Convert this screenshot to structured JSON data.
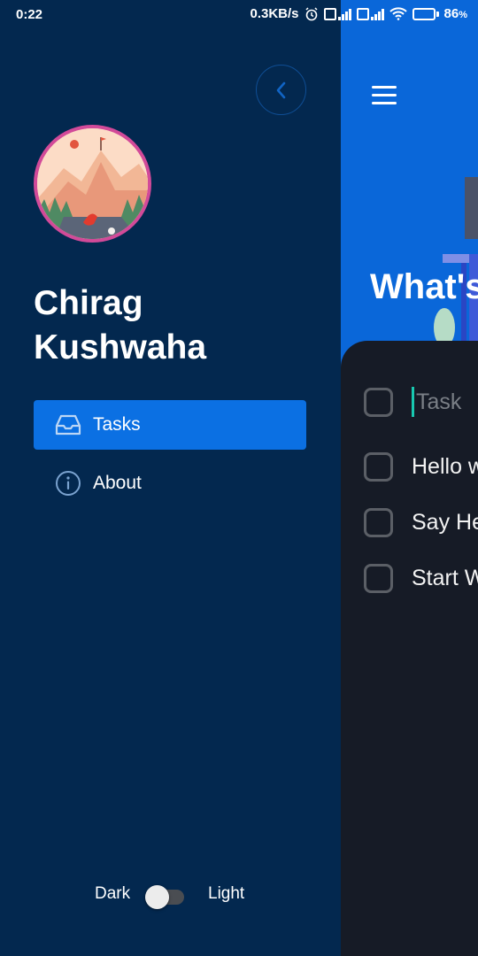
{
  "status_bar": {
    "time": "0:22",
    "net_speed": "0.3KB/s",
    "battery_level": "86",
    "battery_unit": "%",
    "icons": [
      "alarm-icon",
      "sim-signal-icon",
      "sim-signal-icon",
      "wifi-icon",
      "battery-icon"
    ]
  },
  "drawer": {
    "back_icon": "chevron-left-icon",
    "profile_name": "Chirag Kushwaha",
    "nav": [
      {
        "label": "Tasks",
        "icon": "inbox-tray-icon",
        "active": true
      },
      {
        "label": "About",
        "icon": "info-circle-icon",
        "active": false
      }
    ],
    "theme_toggle": {
      "left_label": "Dark",
      "right_label": "Light",
      "is_light": false
    }
  },
  "main": {
    "menu_icon": "hamburger-menu-icon",
    "heading": "What's",
    "task_input": {
      "placeholder": "Task"
    },
    "tasks": [
      {
        "text": "Hello w",
        "done": false
      },
      {
        "text": "Say He",
        "done": false
      },
      {
        "text": "Start W",
        "done": false
      }
    ]
  },
  "colors": {
    "drawer_bg": "#03284f",
    "accent": "#0b70e3",
    "main_bg": "#0a67d9",
    "sheet_bg": "#161b26",
    "avatar_ring": "#d24a99",
    "caret": "#18c8b0"
  }
}
